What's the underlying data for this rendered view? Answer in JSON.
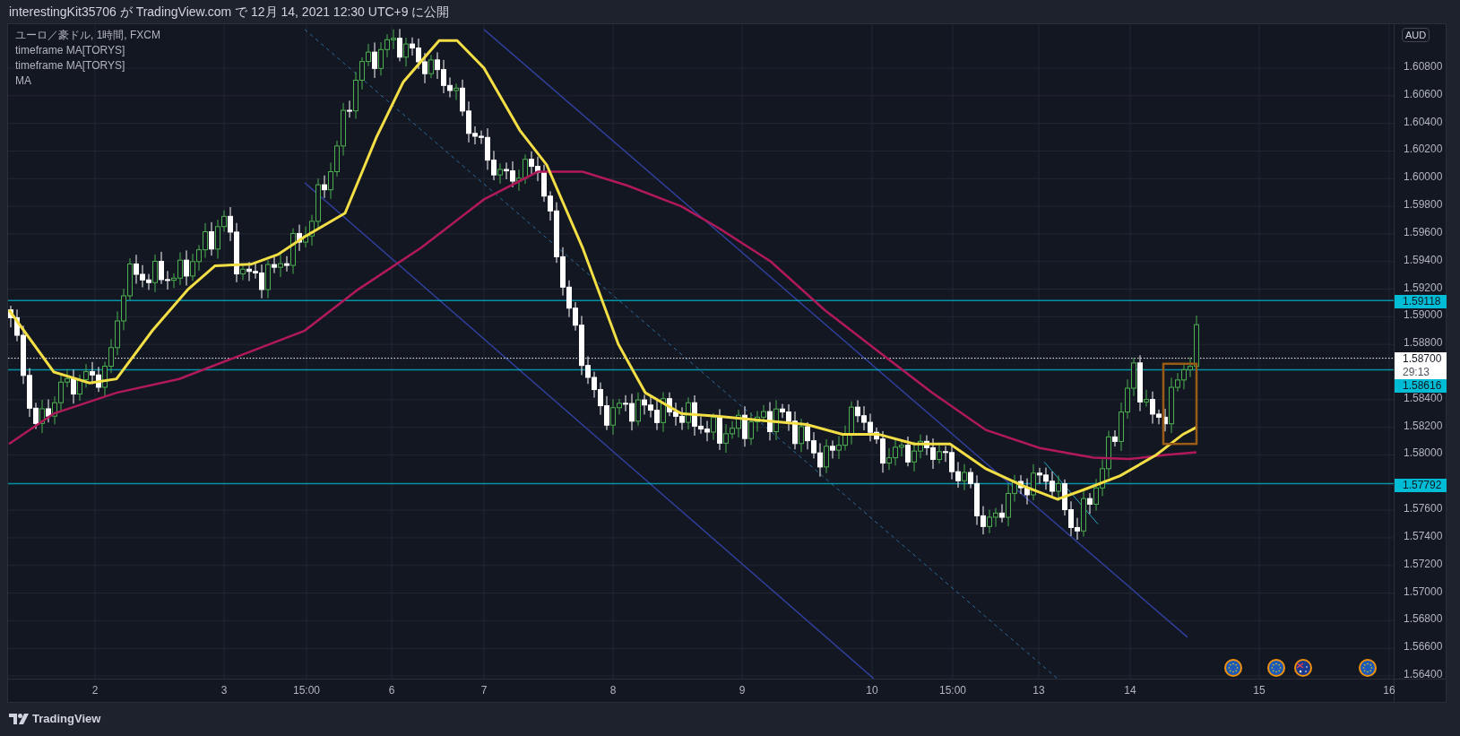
{
  "header": {
    "title": "interestingKit35706 が TradingView.com で 12月 14, 2021 12:30 UTC+9 に公開"
  },
  "legend": [
    "ユーロ／豪ドル, 1時間, FXCM",
    "timeframe MA[TORYS]",
    "timeframe MA[TORYS]",
    "MA"
  ],
  "price_axis": {
    "currency": "AUD",
    "ticks": [
      "1.60800",
      "1.60600",
      "1.60400",
      "1.60200",
      "1.60000",
      "1.59800",
      "1.59600",
      "1.59400",
      "1.59200",
      "1.59000",
      "1.58800",
      "1.58400",
      "1.58200",
      "1.58000",
      "1.57600",
      "1.57400",
      "1.57200",
      "1.57000",
      "1.56800",
      "1.56600",
      "1.56400"
    ]
  },
  "price_tags": [
    {
      "price": "1.59118",
      "color": "#00bcd4"
    },
    {
      "price": "1.58616",
      "color": "#00bcd4"
    },
    {
      "price": "1.57792",
      "color": "#00bcd4"
    }
  ],
  "current_price": {
    "price": "1.58700",
    "countdown": "29:13"
  },
  "time_axis": {
    "labels": [
      "2",
      "3",
      "15:00",
      "6",
      "7",
      "8",
      "9",
      "10",
      "15:00",
      "13",
      "14",
      "15",
      "16"
    ]
  },
  "events": [
    {
      "kind": "eu"
    },
    {
      "kind": "eu"
    },
    {
      "kind": "au"
    },
    {
      "kind": "eu"
    }
  ],
  "footer": {
    "brand": "TradingView"
  }
}
